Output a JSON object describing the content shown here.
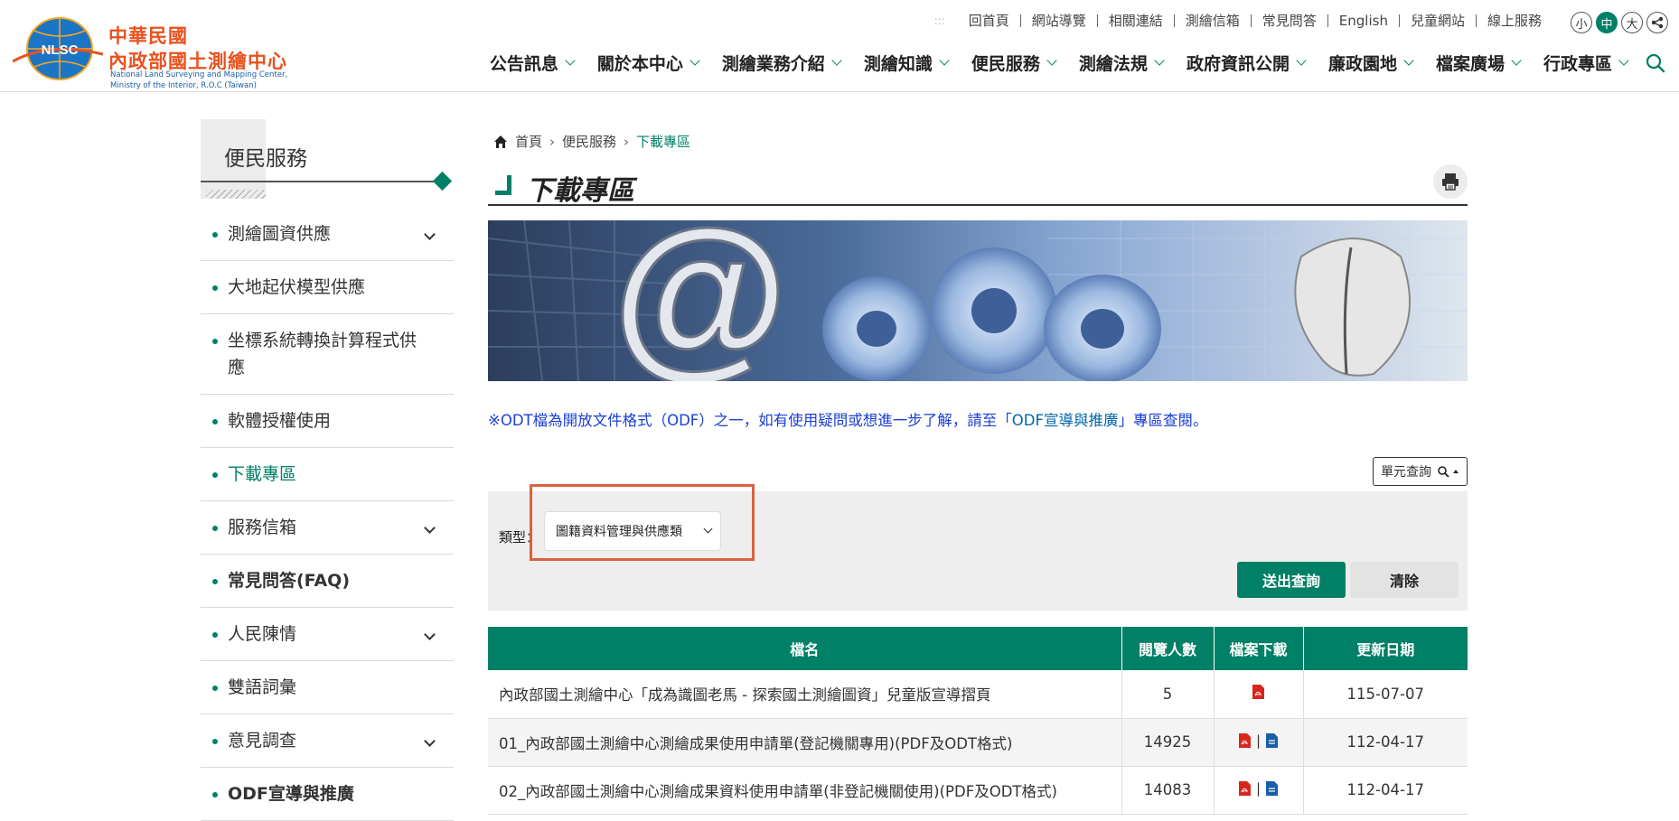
{
  "header": {
    "logo_cn_line1": "中華民國",
    "logo_cn_line2": "內政部國土測繪中心",
    "logo_en_line1": "National Land Surveying and Mapping Center,",
    "logo_en_line2": "Ministry of the Interior, R.O.C (Taiwan)",
    "logo_badge": "NLSC",
    "top_links": [
      "回首頁",
      "網站導覽",
      "相關連結",
      "測繪信箱",
      "常見問答",
      "English",
      "兒童網站",
      "線上服務"
    ],
    "font_sizes": [
      "小",
      "中",
      "大"
    ],
    "nav": [
      "公告訊息",
      "關於本中心",
      "測繪業務介紹",
      "測繪知識",
      "便民服務",
      "測繪法規",
      "政府資訊公開",
      "廉政園地",
      "檔案廣場",
      "行政專區"
    ]
  },
  "sidebar": {
    "title": "便民服務",
    "items": [
      {
        "label": "測繪圖資供應",
        "expandable": true
      },
      {
        "label": "大地起伏模型供應",
        "expandable": false
      },
      {
        "label": "坐標系統轉換計算程式供應",
        "expandable": false
      },
      {
        "label": "軟體授權使用",
        "expandable": false
      },
      {
        "label": "下載專區",
        "expandable": false,
        "active": true
      },
      {
        "label": "服務信箱",
        "expandable": true
      },
      {
        "label": "常見問答(FAQ)",
        "expandable": false
      },
      {
        "label": "人民陳情",
        "expandable": true
      },
      {
        "label": "雙語詞彙",
        "expandable": false
      },
      {
        "label": "意見調查",
        "expandable": true
      },
      {
        "label": "ODF宣導與推廣",
        "expandable": false
      }
    ]
  },
  "breadcrumb": [
    "首頁",
    "便民服務",
    "下載專區"
  ],
  "page_title": "下載專區",
  "notice": {
    "prefix": "※ODT檔為開放文件格式（ODF）之一，如有使用疑問或想進一步了解，請至「",
    "link": "ODF宣導與推廣",
    "suffix": "」專區查閱。"
  },
  "unit_search_label": "單元查詢",
  "query": {
    "type_label": "類型：",
    "type_selected": "圖籍資料管理與供應類",
    "submit_label": "送出查詢",
    "clear_label": "清除"
  },
  "table": {
    "headers": [
      "檔名",
      "閱覽人數",
      "檔案下載",
      "更新日期"
    ],
    "rows": [
      {
        "name": "內政部國土測繪中心「成為識圖老馬 - 探索國土測繪圖資」兒童版宣導摺頁",
        "views": "5",
        "files": [
          "pdf"
        ],
        "date": "115-07-07"
      },
      {
        "name": "01_內政部國土測繪中心測繪成果使用申請單(登記機關專用)(PDF及ODT格式)",
        "views": "14925",
        "files": [
          "pdf",
          "odt"
        ],
        "date": "112-04-17"
      },
      {
        "name": "02_內政部國土測繪中心測繪成果資料使用申請單(非登記機關使用)(PDF及ODT格式)",
        "views": "14083",
        "files": [
          "pdf",
          "odt"
        ],
        "date": "112-04-17"
      }
    ]
  },
  "colors": {
    "brand": "#008066",
    "logo_orange": "#e8521e",
    "highlight": "#d9623f",
    "notice_blue": "#1a3fd6"
  }
}
